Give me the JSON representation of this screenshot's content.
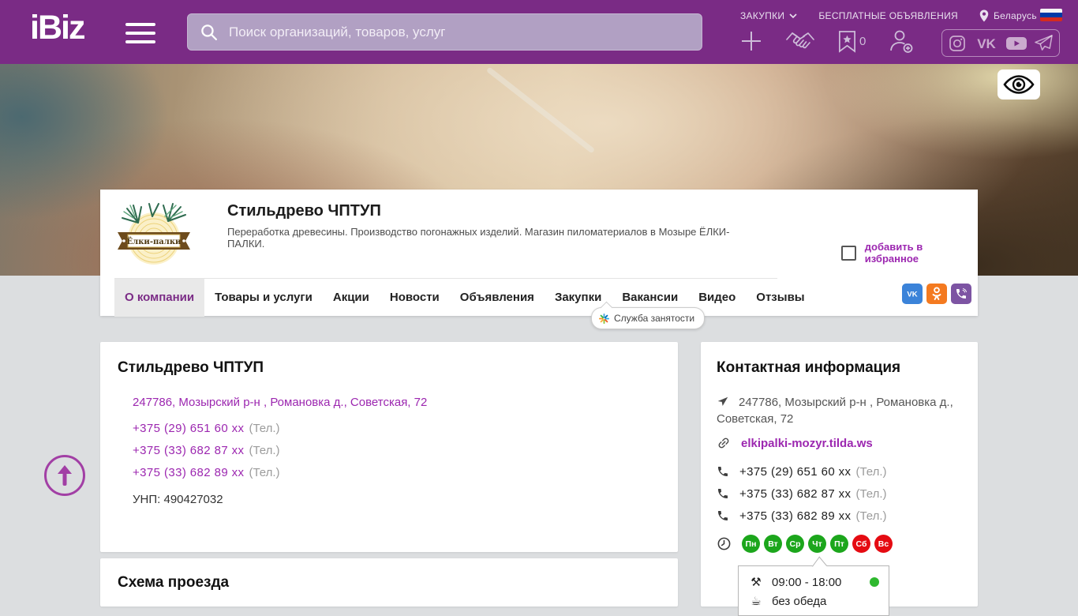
{
  "colors": {
    "header_purple": "#7a2b85",
    "link_purple": "#9c27b0",
    "open_day_green": "#1ca61c",
    "closed_day_red": "#e50b12",
    "status_green": "#2eb82e",
    "vk_blue": "#3b83d9",
    "ok_orange": "#f47a20",
    "viber_purple": "#7d54a3"
  },
  "icons": {
    "tools": "⚒",
    "coffee": "☕"
  },
  "header": {
    "logo_text": "iBiz",
    "search_placeholder": "Поиск организаций, товаров, услуг",
    "menu": {
      "zakupki": "ЗАКУПКИ",
      "free_ads": "БЕСПЛАТНЫЕ ОБЪЯВЛЕНИЯ",
      "country": "Беларусь"
    },
    "favorites_count": "0"
  },
  "company_card": {
    "name": "Стильдрево ЧПТУП",
    "description": "Переработка древесины. Производство погонажных изделий. Магазин пиломатериалов в Мозыре ЁЛКИ-ПАЛКИ.",
    "logo_label": "Ёлки-палки",
    "favorite_label": "добавить в избранное",
    "vacancy_tooltip": "Служба занятости",
    "tabs": [
      {
        "label": "О компании",
        "active": true
      },
      {
        "label": "Товары и услуги",
        "active": false
      },
      {
        "label": "Акции",
        "active": false
      },
      {
        "label": "Новости",
        "active": false
      },
      {
        "label": "Объявления",
        "active": false
      },
      {
        "label": "Закупки",
        "active": false
      },
      {
        "label": "Вакансии",
        "active": false
      },
      {
        "label": "Видео",
        "active": false
      },
      {
        "label": "Отзывы",
        "active": false
      }
    ]
  },
  "about_card": {
    "title": "Стильдрево ЧПТУП",
    "address": "247786, Мозырский р-н , Романовка д., Советская, 72",
    "phones": [
      {
        "number": "+375 (29) 651 60 xx",
        "note": "(Тел.)"
      },
      {
        "number": "+375 (33) 682 87 xx",
        "note": "(Тел.)"
      },
      {
        "number": "+375 (33) 682 89 xx",
        "note": "(Тел.)"
      }
    ],
    "unp": "УНП: 490427032"
  },
  "map_card": {
    "title": "Схема проезда"
  },
  "contact_card": {
    "title": "Контактная информация",
    "address": "247786, Мозырский р-н , Романовка д., Советская, 72",
    "website": "elkipalki-mozyr.tilda.ws",
    "phones": [
      {
        "number": "+375 (29) 651 60 xx",
        "note": "(Тел.)"
      },
      {
        "number": "+375 (33) 682 87 xx",
        "note": "(Тел.)"
      },
      {
        "number": "+375 (33) 682 89 xx",
        "note": "(Тел.)"
      }
    ],
    "days": [
      {
        "label": "Пн",
        "open": true
      },
      {
        "label": "Вт",
        "open": true
      },
      {
        "label": "Ср",
        "open": true
      },
      {
        "label": "Чт",
        "open": true
      },
      {
        "label": "Пт",
        "open": true
      },
      {
        "label": "Сб",
        "open": false
      },
      {
        "label": "Вс",
        "open": false
      }
    ],
    "hours": "09:00 - 18:00",
    "lunch": "без обеда"
  }
}
